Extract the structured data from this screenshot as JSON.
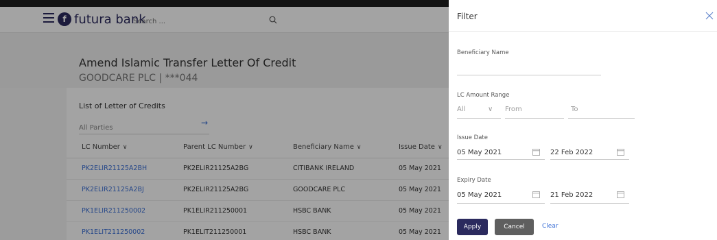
{
  "header": {
    "brand": "futura bank",
    "brand_mark": "f",
    "search_placeholder": "Search ..."
  },
  "page": {
    "title": "Amend Islamic Transfer Letter Of Credit",
    "subtitle": "GOODCARE PLC | ***044"
  },
  "list": {
    "title": "List of Letter of Credits",
    "parties_value": "All Parties",
    "arrow": "→",
    "columns": [
      "LC Number",
      "Parent LC Number",
      "Beneficiary Name",
      "Issue Date"
    ],
    "rows": [
      [
        "PK2ELIR21125A2BH",
        "PK2ELIR21125A2BG",
        "CITIBANK IRELAND",
        "05 May 2021"
      ],
      [
        "PK2ELIR21125A2BJ",
        "PK2ELIR21125A2BG",
        "GOODCARE PLC",
        "05 May 2021"
      ],
      [
        "PK1ELIR211250002",
        "PK1ELIR211250001",
        "HSBC BANK",
        "05 May 2021"
      ],
      [
        "PK1ELIT211250002",
        "PK1ELIT211250001",
        "HSBC BANK",
        "05 May 2021"
      ]
    ]
  },
  "filter": {
    "title": "Filter",
    "beneficiary_label": "Beneficiary Name",
    "beneficiary_value": "",
    "amount_label": "LC Amount Range",
    "currency_value": "All",
    "from_placeholder": "From",
    "to_placeholder": "To",
    "issue_label": "Issue Date",
    "issue_from": "05 May 2021",
    "issue_to": "22 Feb 2022",
    "expiry_label": "Expiry Date",
    "expiry_from": "05 May 2021",
    "expiry_to": "21 Feb 2022",
    "apply_label": "Apply",
    "cancel_label": "Cancel",
    "clear_label": "Clear"
  },
  "colors": {
    "brand": "#2b2a5e",
    "link": "#3b6fd6",
    "cancel": "#5f5f5f"
  },
  "icons": [
    "hamburger-icon",
    "logo-icon",
    "search-icon",
    "arrow-right-icon",
    "chevron-down-icon",
    "close-icon",
    "calendar-icon"
  ]
}
